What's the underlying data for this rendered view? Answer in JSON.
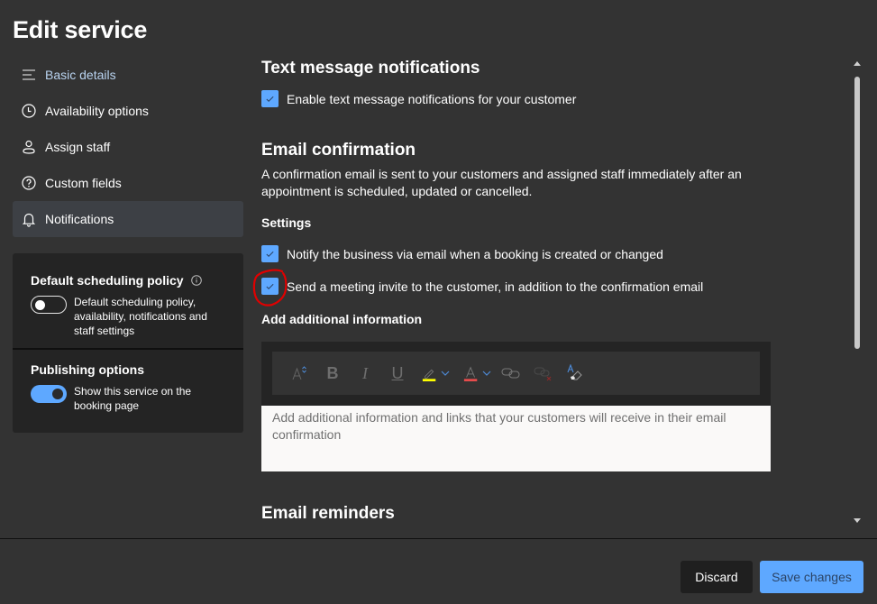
{
  "page": {
    "title": "Edit service"
  },
  "nav": {
    "items": [
      {
        "label": "Basic details",
        "icon": "list-lines-icon"
      },
      {
        "label": "Availability options",
        "icon": "clock-icon"
      },
      {
        "label": "Assign staff",
        "icon": "person-icon"
      },
      {
        "label": "Custom fields",
        "icon": "question-circle-icon"
      },
      {
        "label": "Notifications",
        "icon": "bell-icon",
        "selected": true
      }
    ]
  },
  "policy": {
    "default_title": "Default scheduling policy",
    "default_toggle_on": false,
    "default_desc": "Default scheduling policy, availability, notifications and staff settings",
    "publishing_title": "Publishing options",
    "publishing_toggle_on": true,
    "publishing_desc": "Show this service on the booking page"
  },
  "content": {
    "sms_title": "Text message notifications",
    "sms_checkbox": {
      "label": "Enable text message notifications for your customer",
      "checked": true
    },
    "email_title": "Email confirmation",
    "email_desc": "A confirmation email is sent to your customers and assigned staff immediately after an appointment is scheduled, updated or cancelled.",
    "settings_label": "Settings",
    "notify_checkbox": {
      "label": "Notify the business via email when a booking is created or changed",
      "checked": true
    },
    "invite_checkbox": {
      "label": "Send a meeting invite to the customer, in addition to the confirmation email",
      "checked": true
    },
    "additional_label": "Add additional information",
    "editor_placeholder": "Add additional information and links that your customers will receive in their email confirmation",
    "reminders_title": "Email reminders"
  },
  "toolbar": {
    "tools": [
      "font-size-icon",
      "bold-icon",
      "italic-icon",
      "underline-icon",
      "highlight-icon",
      "font-color-icon",
      "link-icon",
      "unlink-icon",
      "clear-format-icon"
    ],
    "bold_glyph": "B",
    "italic_glyph": "I",
    "underline_glyph": "U",
    "font_color_glyph": "A",
    "highlight_color": "#ffff00",
    "font_color": "#e74c4c"
  },
  "footer": {
    "discard_label": "Discard",
    "save_label": "Save changes"
  },
  "colors": {
    "accent": "#5ea8ff",
    "annotation": "#e00000"
  }
}
